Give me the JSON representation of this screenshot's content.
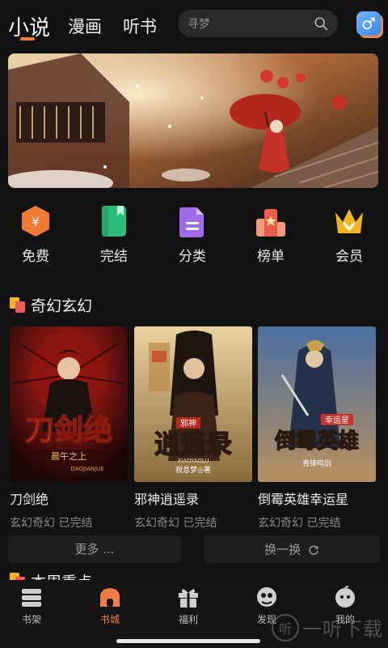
{
  "header": {
    "tabs": [
      {
        "label": "小说",
        "active": true
      },
      {
        "label": "漫画"
      },
      {
        "label": "听书"
      }
    ],
    "search_placeholder": "寻梦",
    "gender_symbol": "♂"
  },
  "quicknav": [
    {
      "label": "免费",
      "icon": "free-coin-icon"
    },
    {
      "label": "完结",
      "icon": "finished-book-icon"
    },
    {
      "label": "分类",
      "icon": "category-doc-icon"
    },
    {
      "label": "榜单",
      "icon": "ranking-icon"
    },
    {
      "label": "会员",
      "icon": "vip-crown-icon"
    }
  ],
  "section": {
    "title": "奇幻玄幻",
    "books": [
      {
        "title": "刀剑绝",
        "meta": "玄幻奇幻 已完结",
        "cover_text": "刀剑绝",
        "cover_sub": "晨午之上",
        "cover_en": "DAOJIANJUE"
      },
      {
        "title": "邪神逍遥录",
        "meta": "玄幻奇幻 已完结",
        "cover_text": "逍遥录",
        "cover_top": "邪神",
        "cover_author": "寂息梦◎著",
        "cover_en": "XIAOYAOLU"
      },
      {
        "title": "倒霉英雄幸运星",
        "meta": "玄幻奇幻 已完结",
        "cover_text": "倒霉英雄",
        "cover_top": "幸运星",
        "cover_author": "青锋鸣剑"
      }
    ],
    "more_label": "更多 ...",
    "swap_label": "换一换",
    "next_title": "本周重点"
  },
  "bottomnav": [
    {
      "label": "书架",
      "icon": "bookshelf-icon"
    },
    {
      "label": "书城",
      "icon": "bookstore-icon",
      "active": true
    },
    {
      "label": "福利",
      "icon": "gift-icon"
    },
    {
      "label": "发现",
      "icon": "discover-icon"
    },
    {
      "label": "我的",
      "icon": "profile-icon"
    }
  ],
  "watermark": "一听下载",
  "colors": {
    "accent": "#ef7c44",
    "background": "#121212"
  }
}
